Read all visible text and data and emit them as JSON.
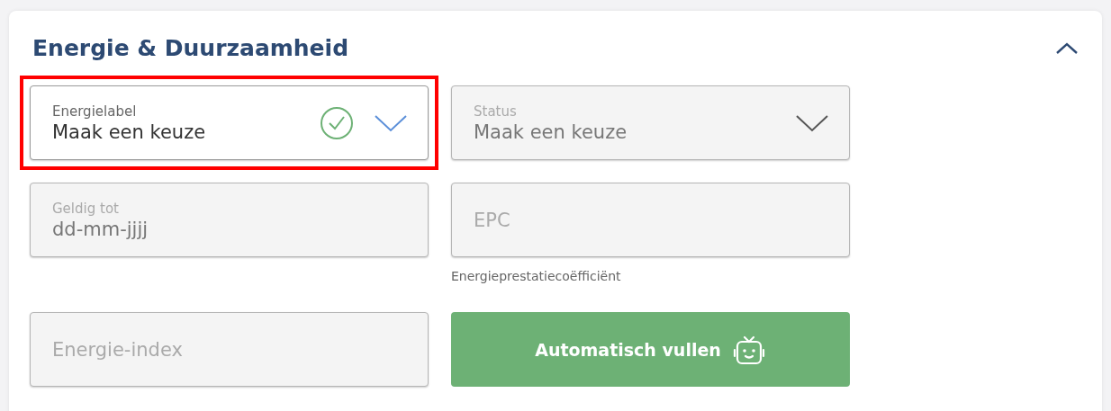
{
  "section": {
    "title": "Energie & Duurzaamheid",
    "expanded": true
  },
  "fields": [
    {
      "kind": "select",
      "label": "Energielabel",
      "value": "Maak een keuze",
      "disabled": false,
      "valid": true,
      "highlighted": true
    },
    {
      "kind": "select",
      "label": "Status",
      "value": "Maak een keuze",
      "disabled": true,
      "valid": false,
      "highlighted": false
    },
    {
      "kind": "date",
      "label": "Geldig tot",
      "value": "dd-mm-jjjj",
      "disabled": true,
      "valid": false,
      "highlighted": false
    },
    {
      "kind": "text",
      "placeholder": "EPC",
      "hint": "Energieprestatiecoëfficiënt",
      "disabled": true,
      "valid": false,
      "highlighted": false
    },
    {
      "kind": "text",
      "placeholder": "Energie-index",
      "disabled": true,
      "valid": false,
      "highlighted": false
    },
    {
      "kind": "button",
      "label": "Automatisch vullen"
    }
  ]
}
